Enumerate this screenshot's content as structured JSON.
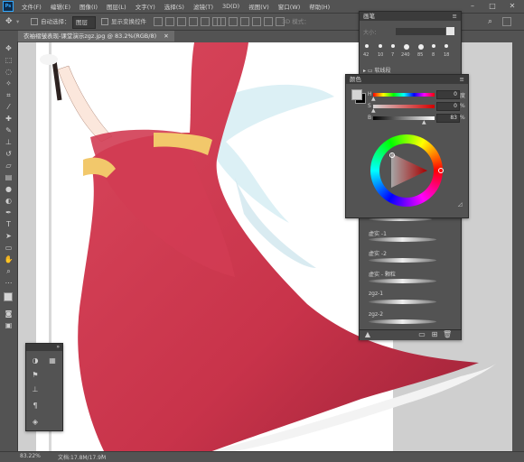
{
  "menubar": {
    "logo": "Ps",
    "items": [
      "文件(F)",
      "编辑(E)",
      "图像(I)",
      "图层(L)",
      "文字(Y)",
      "选择(S)",
      "滤镜(T)",
      "3D(D)",
      "视图(V)",
      "窗口(W)",
      "帮助(H)"
    ],
    "minimize": "–",
    "maximize": "□",
    "close": "✕"
  },
  "options": {
    "auto_select_label": "自动选择：",
    "auto_select_value": "图层",
    "show_transform_label": "显示变换控件",
    "mode_3d_label": "3D 模式："
  },
  "document": {
    "tab_title": "衣袖褶皱表现-课堂演示zgz.jpg @ 83.2%(RGB/8)",
    "close": "✕"
  },
  "status": {
    "zoom": "83.22%",
    "doc_info": "文档:17.8M/17.9M"
  },
  "brush_panel": {
    "title": "画笔",
    "size_label": "大小：",
    "brush_sizes": [
      "42",
      "10",
      "7",
      "240",
      "85",
      "8",
      "18"
    ],
    "group_label": "软线段",
    "brushes": [
      "虚实 -1",
      "虚实 -2",
      "虚实 - 颗粒",
      "zgz-1",
      "zgz-2"
    ]
  },
  "color_panel": {
    "title": "颜色",
    "h_label": "H",
    "s_label": "S",
    "b_label": "B",
    "h_value": "0",
    "s_value": "0",
    "b_value": "83",
    "h_unit": "度",
    "s_unit": "%",
    "b_unit": "%",
    "foreground": "#d4d4d4",
    "background": "#000000"
  },
  "colors": {
    "robe": "#c8334a",
    "sash": "#f2c86b",
    "ribbon": "#cfe6ee",
    "ps_blue": "#31a8ff"
  }
}
